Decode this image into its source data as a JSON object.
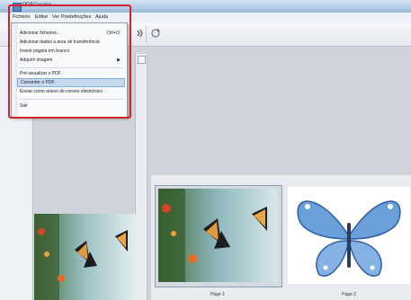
{
  "window": {
    "title": "PDFCreator"
  },
  "menubar": {
    "items": [
      "Ficheiro",
      "Editar",
      "Ver",
      "Predefinições",
      "Ajuda"
    ]
  },
  "file_menu": {
    "items": [
      {
        "label": "Adicionar ficheiros...",
        "shortcut": "Ctrl+O"
      },
      {
        "label": "Adicionar dados a área de transferência",
        "shortcut": ""
      },
      {
        "label": "Inserir página em branco",
        "shortcut": ""
      },
      {
        "label": "Adquirir imagem",
        "shortcut": "",
        "submenu": true
      },
      {
        "label": "Pré-visualizar o PDF",
        "shortcut": ""
      },
      {
        "label": "Converter o PDF",
        "shortcut": ""
      },
      {
        "label": "Enviar como anexo de correio electrónico",
        "shortcut": ""
      },
      {
        "label": "Sair",
        "shortcut": ""
      }
    ],
    "highlighted_index": 5
  },
  "thumbnails": [
    {
      "label": "Page 1",
      "image": "butterflies-on-flowers"
    },
    {
      "label": "Page 2",
      "image": "blue-butterfly"
    }
  ],
  "colors": {
    "accent_highlight": "#c5d9f1",
    "callout_red": "#d2232a"
  }
}
